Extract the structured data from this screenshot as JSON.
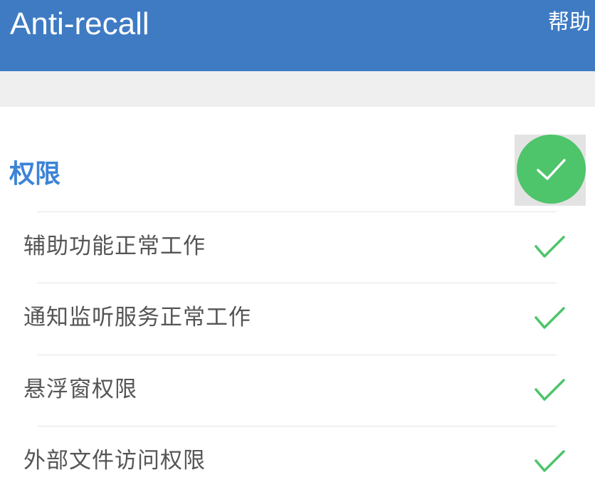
{
  "appbar": {
    "title": "Anti-recall",
    "help_label": "帮助",
    "color": "#3f7bc3"
  },
  "section": {
    "title": "权限",
    "title_color": "#3c83d6",
    "fab_icon": "check-icon",
    "fab_color": "#4ec46b"
  },
  "permissions": [
    {
      "label": "辅助功能正常工作",
      "status_icon": "check-icon"
    },
    {
      "label": "通知监听服务正常工作",
      "status_icon": "check-icon"
    },
    {
      "label": "悬浮窗权限",
      "status_icon": "check-icon"
    },
    {
      "label": "外部文件访问权限",
      "status_icon": "check-icon"
    }
  ],
  "check_color": "#4ec46b"
}
